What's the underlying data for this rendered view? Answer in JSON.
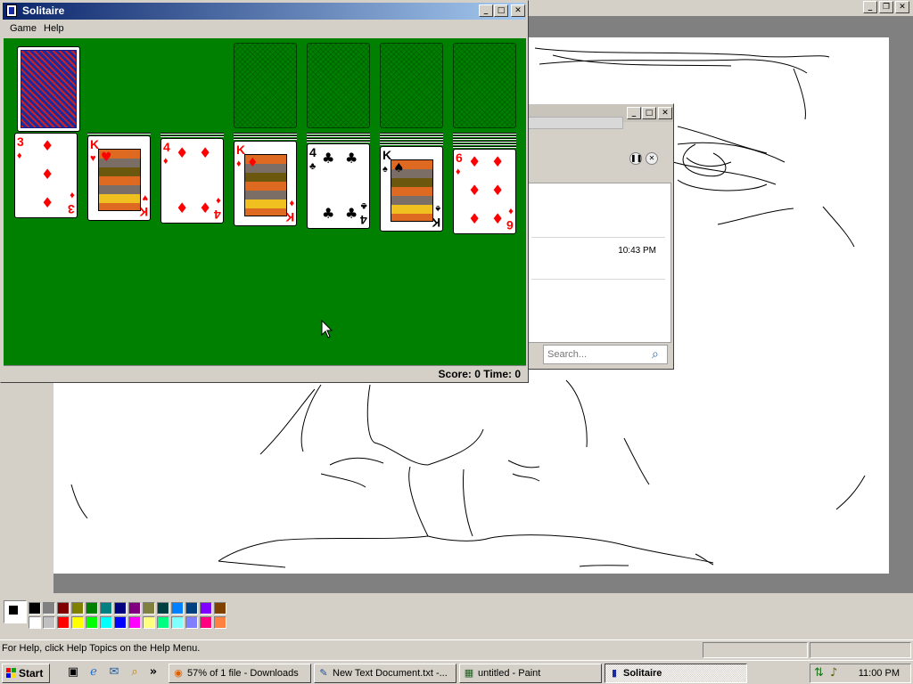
{
  "paint": {
    "status_help": "For Help, click Help Topics on the Help Menu.",
    "palette": [
      "#000000",
      "#808080",
      "#800000",
      "#808000",
      "#008000",
      "#008080",
      "#000080",
      "#800080",
      "#808040",
      "#004040",
      "#0080ff",
      "#004080",
      "#8000ff",
      "#804000",
      "#ffffff",
      "#c0c0c0",
      "#ff0000",
      "#ffff00",
      "#00ff00",
      "#00ffff",
      "#0000ff",
      "#ff00ff",
      "#ffff80",
      "#00ff80",
      "#80ffff",
      "#8080ff",
      "#ff0080",
      "#ff8040"
    ]
  },
  "media": {
    "time": "10:43 PM",
    "search_placeholder": "Search..."
  },
  "solitaire": {
    "title": "Solitaire",
    "menu": [
      "Game",
      "Help"
    ],
    "score_text": "Score: 0 Time: 0",
    "felt_color": "#008000",
    "tableau": [
      {
        "rank": "3",
        "suit": "♦",
        "color": "red"
      },
      {
        "rank": "K",
        "suit": "♥",
        "color": "red"
      },
      {
        "rank": "4",
        "suit": "♦",
        "color": "red"
      },
      {
        "rank": "K",
        "suit": "♦",
        "color": "red"
      },
      {
        "rank": "4",
        "suit": "♣",
        "color": "black"
      },
      {
        "rank": "K",
        "suit": "♠",
        "color": "black"
      },
      {
        "rank": "6",
        "suit": "♦",
        "color": "red"
      }
    ]
  },
  "taskbar": {
    "start": "Start",
    "quicklaunch_more": "»",
    "tasks": [
      {
        "label": "57% of 1 file - Downloads",
        "icon": "firefox-icon"
      },
      {
        "label": "New Text Document.txt -...",
        "icon": "notepad-icon"
      },
      {
        "label": "untitled - Paint",
        "icon": "paint-icon"
      },
      {
        "label": "Solitaire",
        "icon": "solitaire-icon"
      }
    ],
    "clock": "11:00 PM"
  }
}
